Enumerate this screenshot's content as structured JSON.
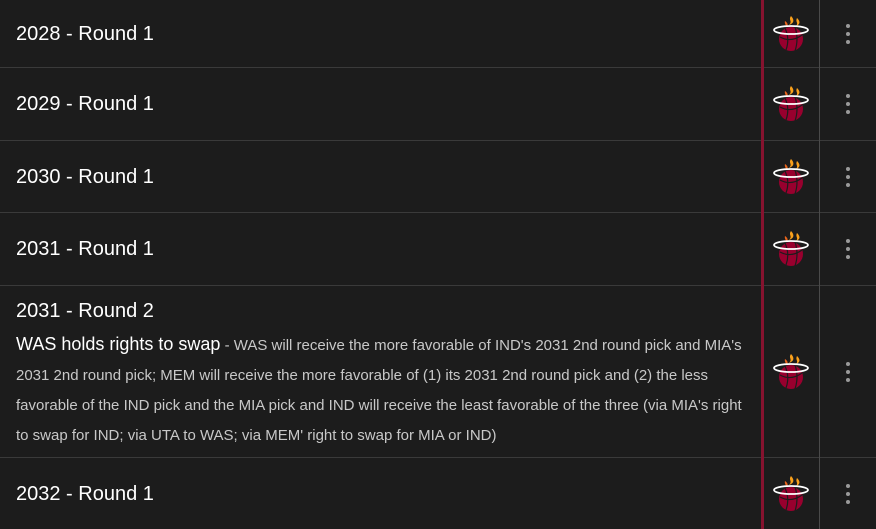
{
  "team_logo": {
    "icon": "miami-heat-logo-icon",
    "colors": {
      "ball": "#98002e",
      "flame": "#f9a01b",
      "rim": "#ffffff"
    }
  },
  "colors": {
    "background": "#1c1c1c",
    "accent": "#86132f",
    "divider": "#3a3a3a"
  },
  "picks": [
    {
      "title": "2028 - Round 1"
    },
    {
      "title": "2029 - Round 1"
    },
    {
      "title": "2030 - Round 1"
    },
    {
      "title": "2031 - Round 1"
    },
    {
      "title": "2031 - Round 2",
      "detail_lead": "WAS holds rights to swap",
      "detail_text": " - WAS will receive the more favorable of IND's 2031 2nd round pick and MIA's 2031 2nd round pick; MEM will receive the more favorable of (1) its 2031 2nd round pick and (2) the less favorable of the IND pick and the MIA pick and IND will receive the least favorable of the three (via MIA's right to swap for IND; via UTA to WAS; via MEM' right to swap for MIA or IND)"
    },
    {
      "title": "2032 - Round 1"
    }
  ]
}
